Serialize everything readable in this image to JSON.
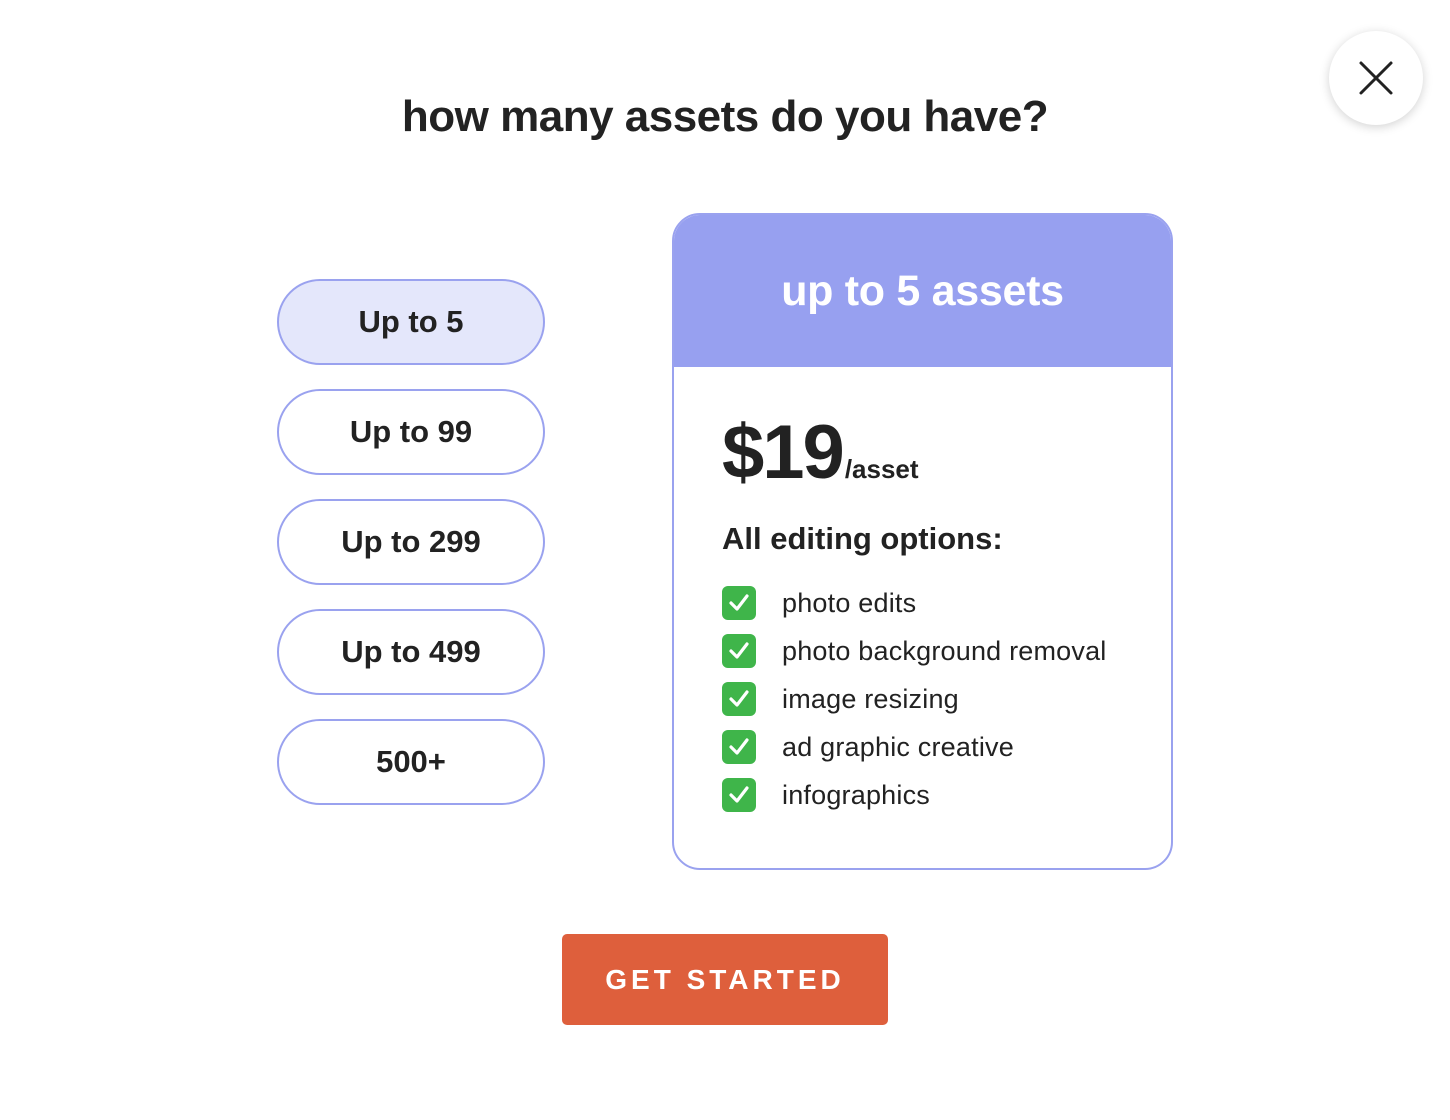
{
  "modal": {
    "title": "how many assets do you have?",
    "close_icon": "close-icon"
  },
  "options": [
    {
      "label": "Up to 5",
      "selected": true
    },
    {
      "label": "Up to 99",
      "selected": false
    },
    {
      "label": "Up to 299",
      "selected": false
    },
    {
      "label": "Up to 499",
      "selected": false
    },
    {
      "label": "500+",
      "selected": false
    }
  ],
  "plan": {
    "header": "up to 5 assets",
    "price": "$19",
    "price_unit": "/asset",
    "features_heading": "All editing options:",
    "check_icon": "check-icon",
    "features": [
      "photo edits",
      "photo background removal",
      "image resizing",
      "ad graphic creative",
      "infographics"
    ]
  },
  "cta": {
    "label": "GET STARTED"
  },
  "colors": {
    "accent": "#97a0f0",
    "border": "#9aa2ef",
    "selected_bg": "#e4e7fb",
    "cta": "#de5f3c",
    "check": "#3fb54a"
  }
}
